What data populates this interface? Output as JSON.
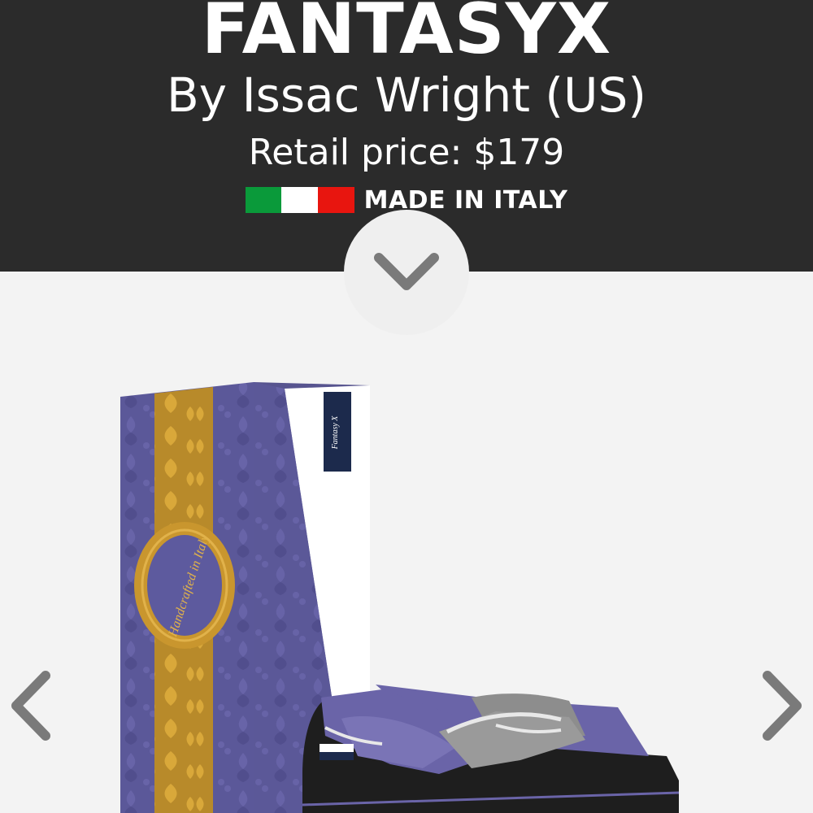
{
  "product": {
    "name": "FANTASYX",
    "designer": "By Issac Wright (US)",
    "price": "Retail price: $179",
    "origin": "MADE IN ITALY",
    "flag_colors": [
      "#0a9a3a",
      "#ffffff",
      "#e8150f"
    ]
  },
  "box": {
    "seal_text": "Handcrafted in Italy",
    "label_text": "Fantasy X"
  },
  "icons": {
    "scroll_down": "chevron-down-icon",
    "previous": "chevron-left-icon",
    "next": "chevron-right-icon"
  },
  "colors": {
    "header_bg": "#2b2b2b",
    "page_bg": "#f3f3f3",
    "box_purple": "#5d5a9e",
    "box_gold": "#c9962e",
    "shoe_purple": "#6a64a8",
    "shoe_grey": "#8d8d8d",
    "chevron": "#7a7a7a"
  }
}
